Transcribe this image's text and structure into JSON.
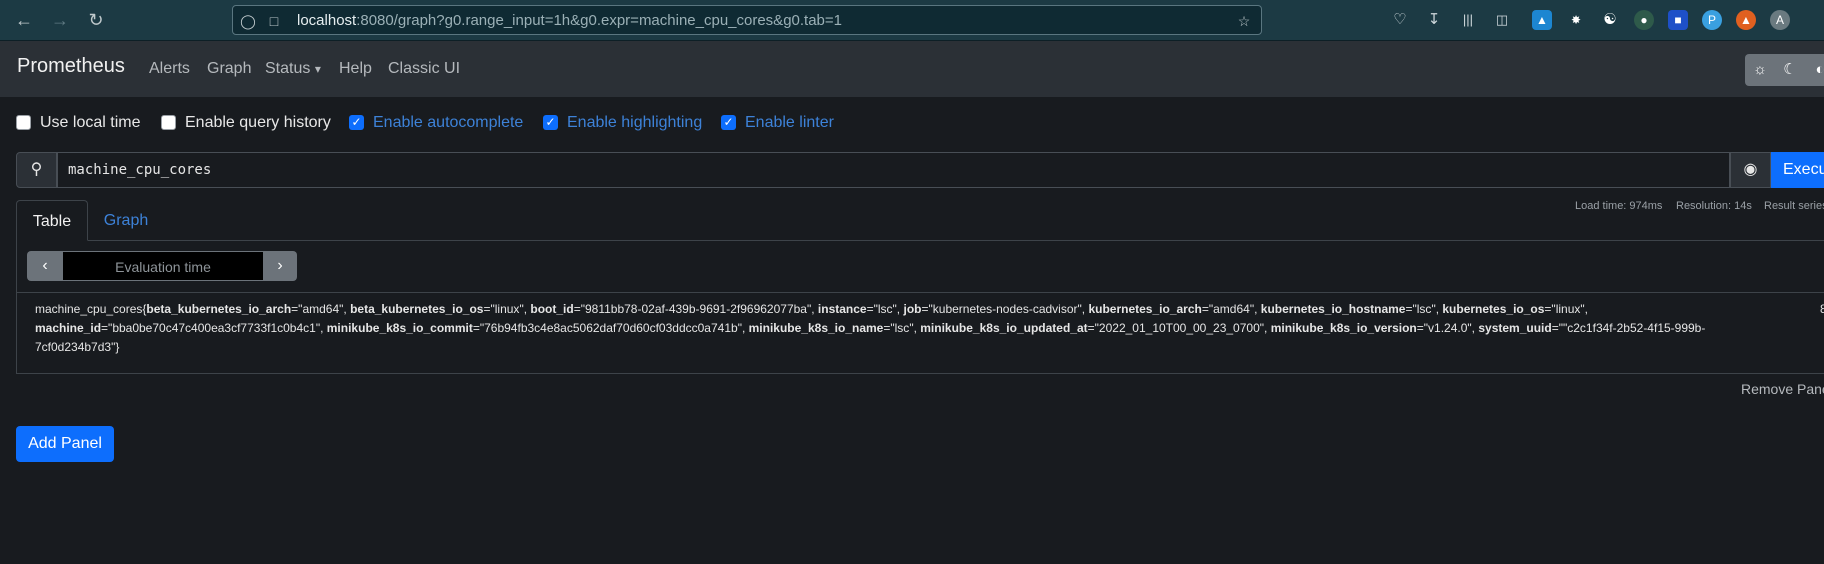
{
  "browser": {
    "url_host": "localhost",
    "url_rest": ":8080/graph?g0.range_input=1h&g0.expr=machine_cpu_cores&g0.tab=1"
  },
  "navbar": {
    "brand": "Prometheus",
    "items": [
      "Alerts",
      "Graph",
      "Status",
      "Help",
      "Classic UI"
    ],
    "status_caret": "▾"
  },
  "options": {
    "use_local_time": {
      "label": "Use local time",
      "checked": false
    },
    "enable_query_history": {
      "label": "Enable query history",
      "checked": false
    },
    "enable_autocomplete": {
      "label": "Enable autocomplete",
      "checked": true
    },
    "enable_highlighting": {
      "label": "Enable highlighting",
      "checked": true
    },
    "enable_linter": {
      "label": "Enable linter",
      "checked": true
    }
  },
  "query": {
    "expression": "machine_cpu_cores",
    "execute_label": "Execute"
  },
  "tabs": {
    "table": "Table",
    "graph": "Graph"
  },
  "stats": {
    "load_time": "Load time: 974ms",
    "resolution": "Resolution: 14s",
    "result_series": "Result series"
  },
  "eval": {
    "placeholder": "Evaluation time",
    "prev": "‹",
    "next": "›"
  },
  "result": {
    "metric_name": "machine_cpu_cores",
    "labels": [
      {
        "name": "beta_kubernetes_io_arch",
        "value": "amd64"
      },
      {
        "name": "beta_kubernetes_io_os",
        "value": "linux"
      },
      {
        "name": "boot_id",
        "value": "9811bb78-02af-439b-9691-2f96962077ba"
      },
      {
        "name": "instance",
        "value": "lsc"
      },
      {
        "name": "job",
        "value": "kubernetes-nodes-cadvisor"
      },
      {
        "name": "kubernetes_io_arch",
        "value": "amd64"
      },
      {
        "name": "kubernetes_io_hostname",
        "value": "lsc"
      },
      {
        "name": "kubernetes_io_os",
        "value": "linux"
      },
      {
        "name": "machine_id",
        "value": "bba0be70c47c400ea3cf7733f1c0b4c1"
      },
      {
        "name": "minikube_k8s_io_commit",
        "value": "76b94fb3c4e8ac5062daf70d60cf03ddcc0a741b"
      },
      {
        "name": "minikube_k8s_io_name",
        "value": "lsc"
      },
      {
        "name": "minikube_k8s_io_updated_at",
        "value": "2022_01_10T00_00_23_0700"
      },
      {
        "name": "minikube_k8s_io_version",
        "value": "v1.24.0"
      },
      {
        "name": "system_uuid",
        "value": "c2c1f34f-2b52-4f15-999b-7cf0d234b7d3"
      }
    ],
    "value": "8"
  },
  "actions": {
    "remove_panel": "Remove Panel",
    "add_panel": "Add Panel"
  }
}
